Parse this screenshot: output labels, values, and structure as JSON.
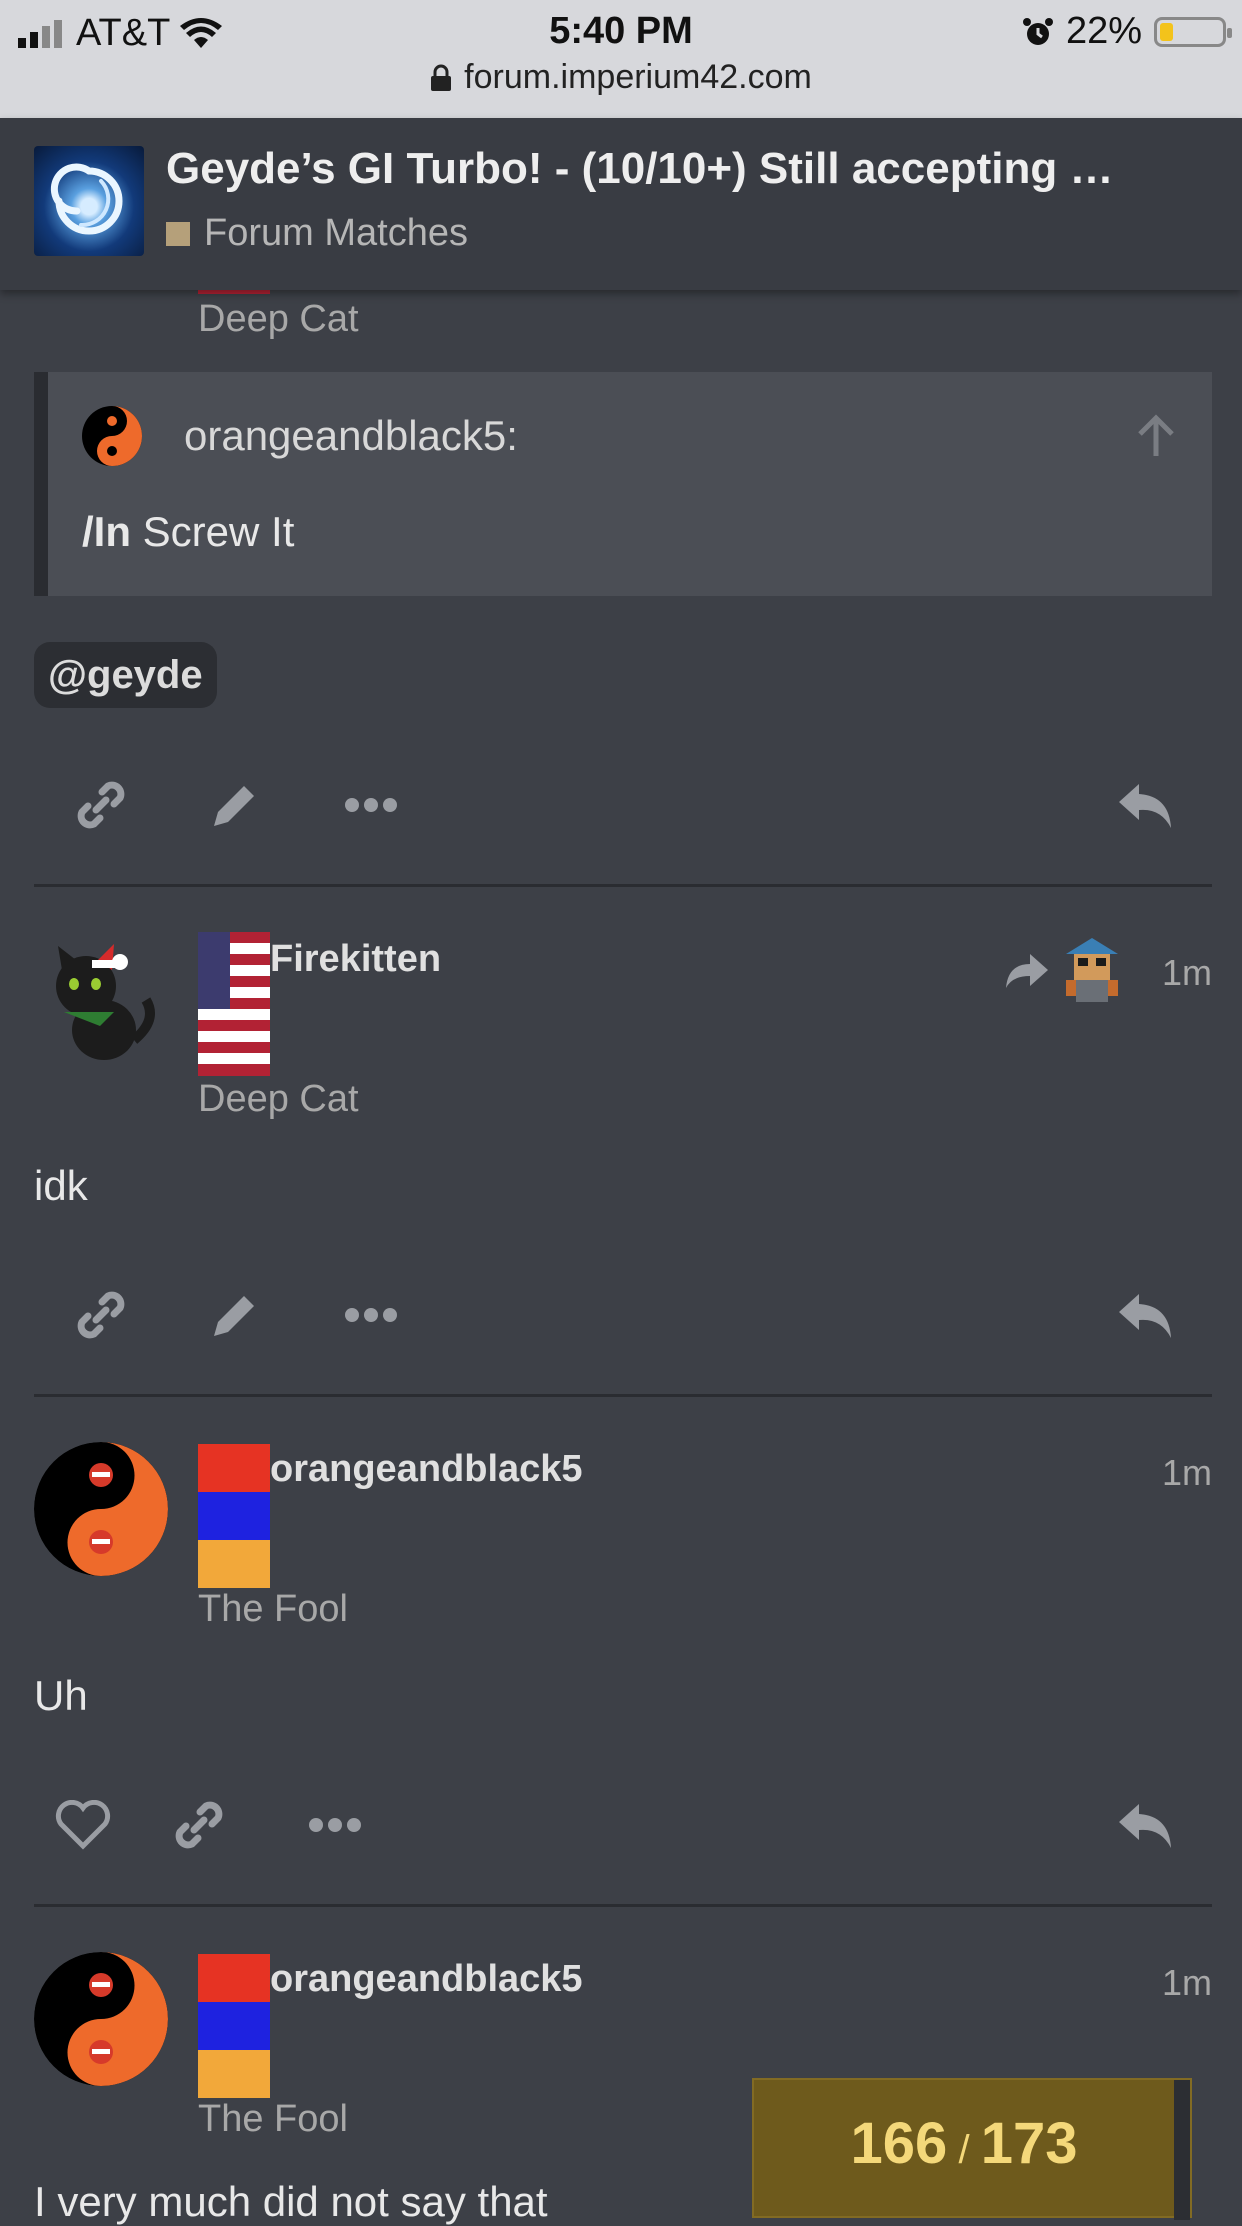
{
  "status_bar": {
    "carrier": "AT&T",
    "time": "5:40 PM",
    "battery_percent_text": "22%",
    "battery_level": 0.22,
    "url": "forum.imperium42.com"
  },
  "topic": {
    "title": "Geyde’s GI Turbo! - (10/10+) Still accepting …",
    "category": "Forum Matches",
    "category_color": "#b5a07a"
  },
  "prev_post": {
    "user_title": "Deep Cat",
    "quote": {
      "username": "orangeandblack5:",
      "text_bold": "/In",
      "text": " Screw It"
    },
    "mention": "@geyde"
  },
  "posts": [
    {
      "username": "Firekitten",
      "user_title": "Deep Cat",
      "time": "1m",
      "body": "idk"
    },
    {
      "username": "orangeandblack5",
      "user_title": "The Fool",
      "time": "1m",
      "body": "Uh"
    },
    {
      "username": "orangeandblack5",
      "user_title": "The Fool",
      "time": "1m",
      "body": "I very much did not say that"
    }
  ],
  "progress": {
    "current": "166",
    "separator": "/",
    "total": "173"
  },
  "colors": {
    "background": "#3d4047",
    "progress_bg": "#6e5a1c",
    "progress_text": "#f4d87a"
  }
}
